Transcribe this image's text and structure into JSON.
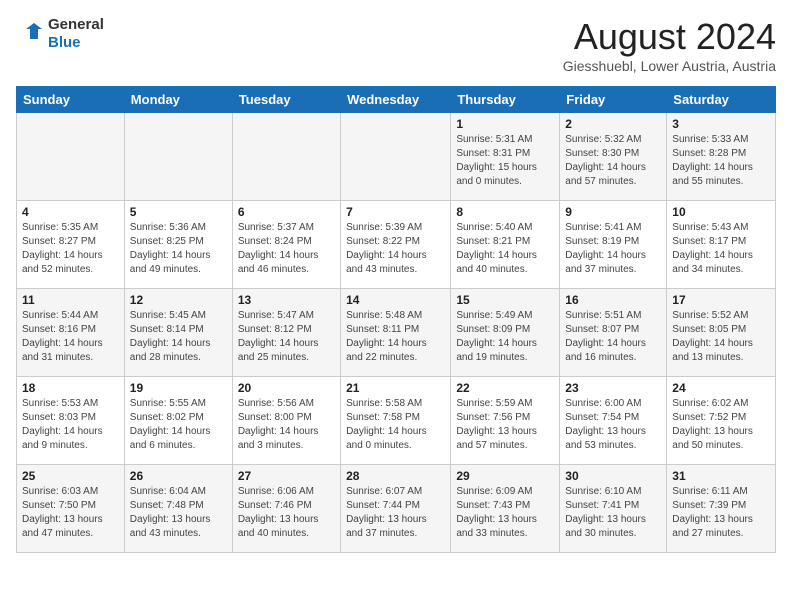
{
  "logo": {
    "line1": "General",
    "line2": "Blue"
  },
  "title": "August 2024",
  "location": "Giesshuebl, Lower Austria, Austria",
  "days_of_week": [
    "Sunday",
    "Monday",
    "Tuesday",
    "Wednesday",
    "Thursday",
    "Friday",
    "Saturday"
  ],
  "weeks": [
    [
      {
        "day": "",
        "content": ""
      },
      {
        "day": "",
        "content": ""
      },
      {
        "day": "",
        "content": ""
      },
      {
        "day": "",
        "content": ""
      },
      {
        "day": "1",
        "content": "Sunrise: 5:31 AM\nSunset: 8:31 PM\nDaylight: 15 hours\nand 0 minutes."
      },
      {
        "day": "2",
        "content": "Sunrise: 5:32 AM\nSunset: 8:30 PM\nDaylight: 14 hours\nand 57 minutes."
      },
      {
        "day": "3",
        "content": "Sunrise: 5:33 AM\nSunset: 8:28 PM\nDaylight: 14 hours\nand 55 minutes."
      }
    ],
    [
      {
        "day": "4",
        "content": "Sunrise: 5:35 AM\nSunset: 8:27 PM\nDaylight: 14 hours\nand 52 minutes."
      },
      {
        "day": "5",
        "content": "Sunrise: 5:36 AM\nSunset: 8:25 PM\nDaylight: 14 hours\nand 49 minutes."
      },
      {
        "day": "6",
        "content": "Sunrise: 5:37 AM\nSunset: 8:24 PM\nDaylight: 14 hours\nand 46 minutes."
      },
      {
        "day": "7",
        "content": "Sunrise: 5:39 AM\nSunset: 8:22 PM\nDaylight: 14 hours\nand 43 minutes."
      },
      {
        "day": "8",
        "content": "Sunrise: 5:40 AM\nSunset: 8:21 PM\nDaylight: 14 hours\nand 40 minutes."
      },
      {
        "day": "9",
        "content": "Sunrise: 5:41 AM\nSunset: 8:19 PM\nDaylight: 14 hours\nand 37 minutes."
      },
      {
        "day": "10",
        "content": "Sunrise: 5:43 AM\nSunset: 8:17 PM\nDaylight: 14 hours\nand 34 minutes."
      }
    ],
    [
      {
        "day": "11",
        "content": "Sunrise: 5:44 AM\nSunset: 8:16 PM\nDaylight: 14 hours\nand 31 minutes."
      },
      {
        "day": "12",
        "content": "Sunrise: 5:45 AM\nSunset: 8:14 PM\nDaylight: 14 hours\nand 28 minutes."
      },
      {
        "day": "13",
        "content": "Sunrise: 5:47 AM\nSunset: 8:12 PM\nDaylight: 14 hours\nand 25 minutes."
      },
      {
        "day": "14",
        "content": "Sunrise: 5:48 AM\nSunset: 8:11 PM\nDaylight: 14 hours\nand 22 minutes."
      },
      {
        "day": "15",
        "content": "Sunrise: 5:49 AM\nSunset: 8:09 PM\nDaylight: 14 hours\nand 19 minutes."
      },
      {
        "day": "16",
        "content": "Sunrise: 5:51 AM\nSunset: 8:07 PM\nDaylight: 14 hours\nand 16 minutes."
      },
      {
        "day": "17",
        "content": "Sunrise: 5:52 AM\nSunset: 8:05 PM\nDaylight: 14 hours\nand 13 minutes."
      }
    ],
    [
      {
        "day": "18",
        "content": "Sunrise: 5:53 AM\nSunset: 8:03 PM\nDaylight: 14 hours\nand 9 minutes."
      },
      {
        "day": "19",
        "content": "Sunrise: 5:55 AM\nSunset: 8:02 PM\nDaylight: 14 hours\nand 6 minutes."
      },
      {
        "day": "20",
        "content": "Sunrise: 5:56 AM\nSunset: 8:00 PM\nDaylight: 14 hours\nand 3 minutes."
      },
      {
        "day": "21",
        "content": "Sunrise: 5:58 AM\nSunset: 7:58 PM\nDaylight: 14 hours\nand 0 minutes."
      },
      {
        "day": "22",
        "content": "Sunrise: 5:59 AM\nSunset: 7:56 PM\nDaylight: 13 hours\nand 57 minutes."
      },
      {
        "day": "23",
        "content": "Sunrise: 6:00 AM\nSunset: 7:54 PM\nDaylight: 13 hours\nand 53 minutes."
      },
      {
        "day": "24",
        "content": "Sunrise: 6:02 AM\nSunset: 7:52 PM\nDaylight: 13 hours\nand 50 minutes."
      }
    ],
    [
      {
        "day": "25",
        "content": "Sunrise: 6:03 AM\nSunset: 7:50 PM\nDaylight: 13 hours\nand 47 minutes."
      },
      {
        "day": "26",
        "content": "Sunrise: 6:04 AM\nSunset: 7:48 PM\nDaylight: 13 hours\nand 43 minutes."
      },
      {
        "day": "27",
        "content": "Sunrise: 6:06 AM\nSunset: 7:46 PM\nDaylight: 13 hours\nand 40 minutes."
      },
      {
        "day": "28",
        "content": "Sunrise: 6:07 AM\nSunset: 7:44 PM\nDaylight: 13 hours\nand 37 minutes."
      },
      {
        "day": "29",
        "content": "Sunrise: 6:09 AM\nSunset: 7:43 PM\nDaylight: 13 hours\nand 33 minutes."
      },
      {
        "day": "30",
        "content": "Sunrise: 6:10 AM\nSunset: 7:41 PM\nDaylight: 13 hours\nand 30 minutes."
      },
      {
        "day": "31",
        "content": "Sunrise: 6:11 AM\nSunset: 7:39 PM\nDaylight: 13 hours\nand 27 minutes."
      }
    ]
  ]
}
